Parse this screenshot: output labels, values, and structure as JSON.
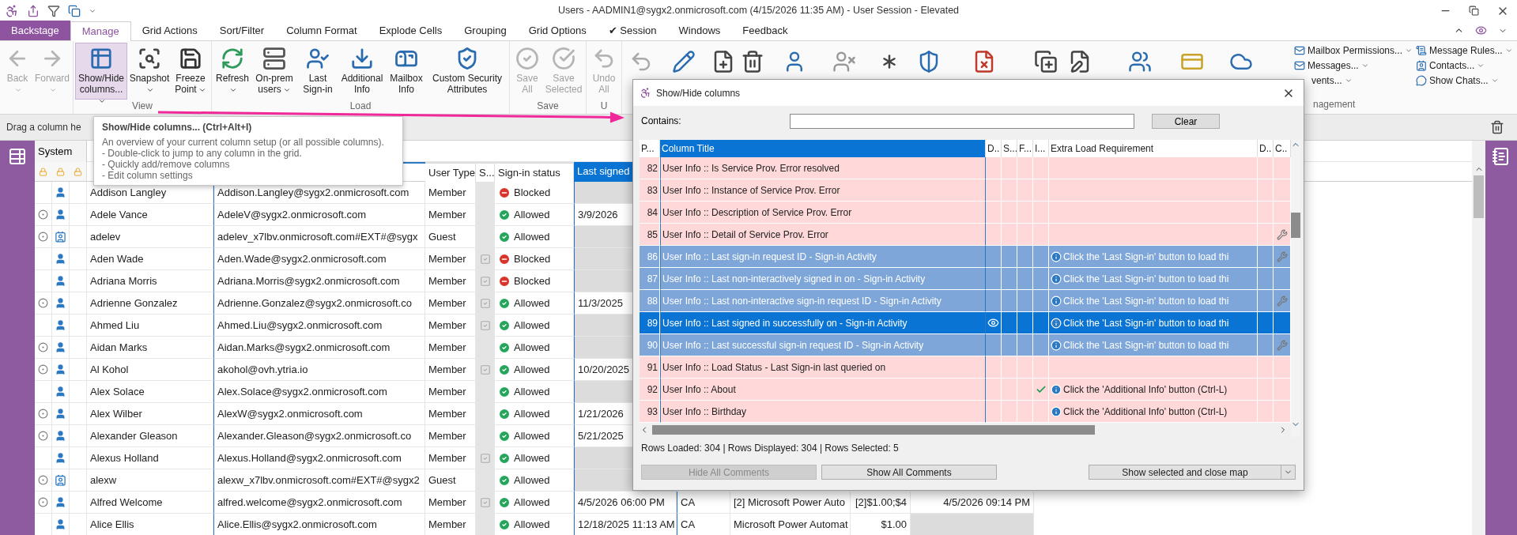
{
  "title_bar": {
    "title": "Users - AADMIN1@sygx2.onmicrosoft.com (4/15/2026 11:35 AM) - User Session - Elevated"
  },
  "tabs": [
    {
      "label": "Backstage",
      "kind": "backstage",
      "selected": false
    },
    {
      "label": "Manage",
      "kind": "tab",
      "selected": true
    },
    {
      "label": "Grid Actions",
      "kind": "tab",
      "selected": false
    },
    {
      "label": "Sort/Filter",
      "kind": "tab",
      "selected": false
    },
    {
      "label": "Column Format",
      "kind": "tab",
      "selected": false
    },
    {
      "label": "Explode Cells",
      "kind": "tab",
      "selected": false
    },
    {
      "label": "Grouping",
      "kind": "tab",
      "selected": false
    },
    {
      "label": "Grid Options",
      "kind": "tab",
      "selected": false
    },
    {
      "label": "✔ Session",
      "kind": "tab",
      "selected": false
    },
    {
      "label": "Windows",
      "kind": "tab",
      "selected": false
    },
    {
      "label": "Feedback",
      "kind": "tab",
      "selected": false
    }
  ],
  "ribbon": {
    "groups": [
      {
        "buttons": [
          {
            "label": "Back",
            "disabled": true,
            "pressed": false,
            "dropdown": true
          },
          {
            "label": "Forward",
            "disabled": true,
            "pressed": false,
            "dropdown": true
          }
        ]
      },
      {
        "label": "View",
        "buttons": [
          {
            "label": "Show/Hide columns...",
            "disabled": false,
            "pressed": true,
            "dropdown": true
          },
          {
            "label": "Snapshot",
            "disabled": false,
            "pressed": false,
            "dropdown": true
          },
          {
            "label": "Freeze Point",
            "disabled": false,
            "pressed": false,
            "dropdown": true
          }
        ]
      },
      {
        "label": "Load",
        "buttons": [
          {
            "label": "Refresh",
            "disabled": false,
            "pressed": false,
            "dropdown": true
          },
          {
            "label": "On-prem users",
            "disabled": false,
            "pressed": false,
            "dropdown": true
          },
          {
            "label": "Last Sign-in",
            "disabled": false,
            "pressed": false,
            "dropdown": false
          },
          {
            "label": "Additional Info",
            "disabled": false,
            "pressed": false,
            "dropdown": false
          },
          {
            "label": "Mailbox Info",
            "disabled": false,
            "pressed": false,
            "dropdown": false
          },
          {
            "label": "Custom Security Attributes",
            "disabled": false,
            "pressed": false,
            "dropdown": false
          }
        ]
      },
      {
        "label": "Save",
        "buttons": [
          {
            "label": "Save All",
            "disabled": true,
            "pressed": false,
            "dropdown": false
          },
          {
            "label": "Save Selected",
            "disabled": true,
            "pressed": false,
            "dropdown": false
          }
        ]
      },
      {
        "label": "U",
        "buttons": [
          {
            "label": "Undo All",
            "disabled": true,
            "pressed": false,
            "dropdown": false
          }
        ]
      }
    ],
    "side_actions": {
      "label": "nagement",
      "items": [
        {
          "label": "Mailbox Permissions...",
          "kind": "full"
        },
        {
          "label": "Messages...",
          "kind": "full"
        },
        {
          "label": "vents...",
          "kind": "cut"
        },
        {
          "label": "Message Rules...",
          "kind": "full"
        },
        {
          "label": "Contacts...",
          "kind": "full"
        },
        {
          "label": "Show Chats...",
          "kind": "full"
        }
      ]
    }
  },
  "group_by_bar": {
    "text": "Drag a column he"
  },
  "tooltip": {
    "title": "Show/Hide columns... (Ctrl+Alt+I)",
    "lines": [
      "An overview of your current column setup (or all possible columns).",
      "- Double-click to jump to any column in the grid.",
      "- Quickly add/remove columns",
      "- Edit column settings"
    ]
  },
  "grid": {
    "group_header": "System",
    "columns": [
      {
        "label": "User Type",
        "selected": false
      },
      {
        "label": "S...",
        "selected": false
      },
      {
        "label": "Sign-in status",
        "selected": false
      },
      {
        "label": "Last signed",
        "selected": true
      }
    ],
    "rows": [
      {
        "flagged": false,
        "kind": "member",
        "name": "Addison Langley",
        "email": "Addison.Langley@sygx2.onmicrosoft.com",
        "user_type": "Member",
        "s_checked": false,
        "status": "Blocked",
        "blocked": true
      },
      {
        "flagged": true,
        "kind": "member",
        "name": "Adele Vance",
        "email": "AdeleV@sygx2.onmicrosoft.com",
        "user_type": "Member",
        "s_checked": false,
        "status": "Allowed",
        "blocked": false,
        "last_signed": "3/9/2026"
      },
      {
        "flagged": true,
        "kind": "guest",
        "name": "adelev",
        "email": "adelev_x7lbv.onmicrosoft.com#EXT#@sygx",
        "user_type": "Guest",
        "s_checked": false,
        "status": "Allowed",
        "blocked": false
      },
      {
        "flagged": false,
        "kind": "member",
        "name": "Aden Wade",
        "email": "Aden.Wade@sygx2.onmicrosoft.com",
        "user_type": "Member",
        "s_checked": true,
        "status": "Blocked",
        "blocked": true
      },
      {
        "flagged": false,
        "kind": "member",
        "name": "Adriana Morris",
        "email": "Adriana.Morris@sygx2.onmicrosoft.com",
        "user_type": "Member",
        "s_checked": true,
        "status": "Blocked",
        "blocked": true
      },
      {
        "flagged": true,
        "kind": "member",
        "name": "Adrienne Gonzalez",
        "email": "Adrienne.Gonzalez@sygx2.onmicrosoft.co",
        "user_type": "Member",
        "s_checked": true,
        "status": "Allowed",
        "blocked": false,
        "last_signed": "11/3/2025"
      },
      {
        "flagged": false,
        "kind": "member",
        "name": "Ahmed Liu",
        "email": "Ahmed.Liu@sygx2.onmicrosoft.com",
        "user_type": "Member",
        "s_checked": true,
        "status": "Allowed",
        "blocked": false
      },
      {
        "flagged": true,
        "kind": "member",
        "name": "Aidan Marks",
        "email": "Aidan.Marks@sygx2.onmicrosoft.com",
        "user_type": "Member",
        "s_checked": false,
        "status": "Allowed",
        "blocked": false
      },
      {
        "flagged": true,
        "kind": "member",
        "name": "Al Kohol",
        "email": "akohol@ovh.ytria.io",
        "user_type": "Member",
        "s_checked": true,
        "status": "Allowed",
        "blocked": false,
        "last_signed": "10/20/2025"
      },
      {
        "flagged": false,
        "kind": "member",
        "name": "Alex Solace",
        "email": "Alex.Solace@sygx2.onmicrosoft.com",
        "user_type": "Member",
        "s_checked": false,
        "status": "Allowed",
        "blocked": false
      },
      {
        "flagged": true,
        "kind": "member",
        "name": "Alex Wilber",
        "email": "AlexW@sygx2.onmicrosoft.com",
        "user_type": "Member",
        "s_checked": false,
        "status": "Allowed",
        "blocked": false,
        "last_signed": "1/21/2026"
      },
      {
        "flagged": true,
        "kind": "member",
        "name": "Alexander Gleason",
        "email": "Alexander.Gleason@sygx2.onmicrosoft.co",
        "user_type": "Member",
        "s_checked": false,
        "status": "Allowed",
        "blocked": false,
        "last_signed": "5/21/2025"
      },
      {
        "flagged": false,
        "kind": "member",
        "name": "Alexus Holland",
        "email": "Alexus.Holland@sygx2.onmicrosoft.com",
        "user_type": "Member",
        "s_checked": true,
        "status": "Allowed",
        "blocked": false
      },
      {
        "flagged": true,
        "kind": "guest",
        "name": "alexw",
        "email": "alexw_x7lbv.onmicrosoft.com#EXT#@sygx2",
        "user_type": "Guest",
        "s_checked": false,
        "status": "Allowed",
        "blocked": false
      },
      {
        "flagged": true,
        "kind": "member",
        "name": "Alfred Welcome",
        "email": "alfred.welcome@sygx2.onmicrosoft.com",
        "user_type": "Member",
        "s_checked": true,
        "status": "Allowed",
        "blocked": false,
        "last_signed": "4/5/2026 06:00 PM",
        "extra": [
          "CA",
          "[2] Microsoft Power Auto",
          "[2]$1.00;$4",
          "4/5/2026 09:14 PM"
        ]
      },
      {
        "flagged": false,
        "kind": "member",
        "name": "Alice Ellis",
        "email": "Alice.Ellis@sygx2.onmicrosoft.com",
        "user_type": "Member",
        "s_checked": false,
        "status": "Allowed",
        "blocked": false,
        "last_signed": "12/18/2025 11:13 AM",
        "extra": [
          "CA",
          "Microsoft Power Automat",
          "$1.00"
        ]
      }
    ]
  },
  "dialog": {
    "title": "Show/Hide columns",
    "filter_label": "Contains:",
    "clear_button": "Clear",
    "columns": [
      {
        "label": "P...",
        "selected": false
      },
      {
        "label": "Column Title",
        "selected": true
      },
      {
        "label": "D..",
        "selected": false
      },
      {
        "label": "S...",
        "selected": false
      },
      {
        "label": "F...",
        "selected": false
      },
      {
        "label": "I...",
        "selected": false
      },
      {
        "label": "Extra Load Requirement",
        "selected": false
      },
      {
        "label": "D..",
        "selected": false
      },
      {
        "label": "C..",
        "selected": false
      }
    ],
    "rows": [
      {
        "number": "82",
        "title": "User Info :: Is Service Prov. Error resolved",
        "selected": false,
        "focused": false,
        "d_eye": false,
        "i_check": false,
        "c_wrench": false
      },
      {
        "number": "83",
        "title": "User Info :: Instance of Service Prov. Error",
        "selected": false,
        "focused": false,
        "d_eye": false,
        "i_check": false,
        "c_wrench": false
      },
      {
        "number": "84",
        "title": "User Info :: Description of Service Prov. Error",
        "selected": false,
        "focused": false,
        "d_eye": false,
        "i_check": false,
        "c_wrench": false
      },
      {
        "number": "85",
        "title": "User Info :: Detail of Service Prov. Error",
        "selected": false,
        "focused": false,
        "d_eye": false,
        "i_check": false,
        "c_wrench": true
      },
      {
        "number": "86",
        "title": "User Info :: Last sign-in request ID - Sign-in Activity",
        "selected": true,
        "focused": false,
        "d_eye": false,
        "i_check": false,
        "c_wrench": true,
        "requirement": "Click the 'Last Sign-in' button to load thi"
      },
      {
        "number": "87",
        "title": "User Info :: Last non-interactively signed in on - Sign-in Activity",
        "selected": true,
        "focused": false,
        "d_eye": false,
        "i_check": false,
        "c_wrench": false,
        "requirement": "Click the 'Last Sign-in' button to load thi"
      },
      {
        "number": "88",
        "title": "User Info :: Last non-interactive sign-in request ID - Sign-in Activity",
        "selected": true,
        "focused": false,
        "d_eye": false,
        "i_check": false,
        "c_wrench": true,
        "requirement": "Click the 'Last Sign-in' button to load thi"
      },
      {
        "number": "89",
        "title": "User Info :: Last signed in successfully on - Sign-in Activity",
        "selected": true,
        "focused": true,
        "d_eye": true,
        "i_check": false,
        "c_wrench": false,
        "requirement": "Click the 'Last Sign-in' button to load thi"
      },
      {
        "number": "90",
        "title": "User Info :: Last successful sign-in request ID - Sign-in Activity",
        "selected": true,
        "focused": false,
        "d_eye": false,
        "i_check": false,
        "c_wrench": true,
        "requirement": "Click the 'Last Sign-in' button to load thi"
      },
      {
        "number": "91",
        "title": "User Info :: Load Status - Last Sign-in last queried on",
        "selected": false,
        "focused": false,
        "d_eye": false,
        "i_check": false,
        "c_wrench": false
      },
      {
        "number": "92",
        "title": "User Info :: About",
        "selected": false,
        "focused": false,
        "d_eye": false,
        "i_check": true,
        "c_wrench": false,
        "requirement": "Click the 'Additional Info' button (Ctrl-L)"
      },
      {
        "number": "93",
        "title": "User Info :: Birthday",
        "selected": false,
        "focused": false,
        "d_eye": false,
        "i_check": false,
        "c_wrench": false,
        "requirement": "Click the 'Additional Info' button (Ctrl-L)"
      }
    ],
    "status": "Rows Loaded: 304 | Rows Displayed: 304 | Rows Selected: 5",
    "buttons": [
      {
        "label": "Hide All Comments",
        "disabled": true
      },
      {
        "label": "Show All Comments",
        "disabled": false
      }
    ],
    "primary_action": {
      "label": "Show selected and close map"
    }
  }
}
